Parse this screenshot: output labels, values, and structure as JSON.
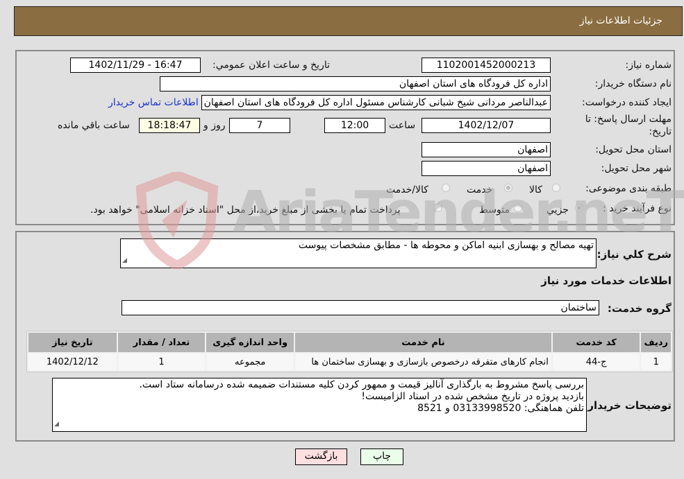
{
  "header": {
    "title": "جزئیات اطلاعات نیاز"
  },
  "form": {
    "need_number": {
      "label": "شماره نیاز:",
      "value": "1102001452000213"
    },
    "announce_datetime": {
      "label": "تاریخ و ساعت اعلان عمومي:",
      "value": "1402/11/29 - 16:47"
    },
    "buyer_org": {
      "label": "نام دستگاه خریدار:",
      "value": "اداره کل فرودگاه های استان اصفهان"
    },
    "requester": {
      "label": "ایجاد کننده درخواست:",
      "value": "عبدالناصر مردانی شیخ شبانی کارشناس مسئول  اداره کل فرودگاه های استان اصفهان"
    },
    "buyer_contact_link": "اطلاعات تماس خریدار",
    "deadline": {
      "label_line1": "مهلت ارسال پاسخ: تا",
      "label_line2": "تاریخ:",
      "date": "1402/12/07",
      "time_label": "ساعت",
      "time": "12:00",
      "days": "7",
      "days_label": "روز و",
      "remaining": "18:18:47",
      "remaining_label": "ساعت باقي مانده"
    },
    "delivery_province": {
      "label": "استان محل تحویل:",
      "value": "اصفهان"
    },
    "delivery_city": {
      "label": "شهر محل تحویل:",
      "value": "اصفهان"
    },
    "category": {
      "label": "طبقه بندی موضوعی:",
      "options": [
        "کالا",
        "خدمت",
        "کالا/خدمت"
      ],
      "selected": "خدمت"
    },
    "purchase_type": {
      "label": "نوع فرآیند خرید :",
      "options": [
        "جزيي",
        "متوسط"
      ],
      "selected": "جزيي",
      "treasury_note": "پرداخت تمام یا بخشی از مبلغ خرید،از محل \"اسناد خزانه اسلامی\" خواهد بود."
    }
  },
  "description": {
    "label": "شرح کلي نياز:",
    "value": "تهیه مصالح  و بهسازی ابنیه اماکن و محوطه ها  - مطابق مشخصات پیوست"
  },
  "services": {
    "section_title": "اطلاعات خدمات مورد نياز",
    "group_label": "گروه خدمت:",
    "group_value": "ساختمان",
    "table": {
      "headers": [
        "رديف",
        "کد خدمت",
        "نام خدمت",
        "واحد اندازه گیری",
        "تعداد / مقدار",
        "تاریخ نیاز"
      ],
      "rows": [
        [
          "1",
          "ج-44",
          "انجام کارهای متفرقه درخصوص بازسازی و بهسازی ساختمان ها",
          "مجموعه",
          "1",
          "1402/12/12"
        ]
      ]
    }
  },
  "buyer_notes": {
    "label": "توضیحات خریدار:",
    "lines": [
      "بررسی پاسخ مشروط  به بارگذاری آنالیز قیمت و ممهور کردن کلیه مستندات ضمیمه شده درسامانه  ستاد است.",
      "بازدید پروژه در تاریخ  مشخص شده در اسناد  الزامیست!",
      "تلفن هماهنگی: 03133998520 و 8521"
    ]
  },
  "buttons": {
    "print": "چاپ",
    "back": "بازگشت"
  },
  "watermark": {
    "text": "AriaTender.neT"
  },
  "colors": {
    "header_bg": "#8b6d42",
    "link": "#1a33cc",
    "print_bg": "#eaffea",
    "back_bg": "#ffe0e0"
  }
}
